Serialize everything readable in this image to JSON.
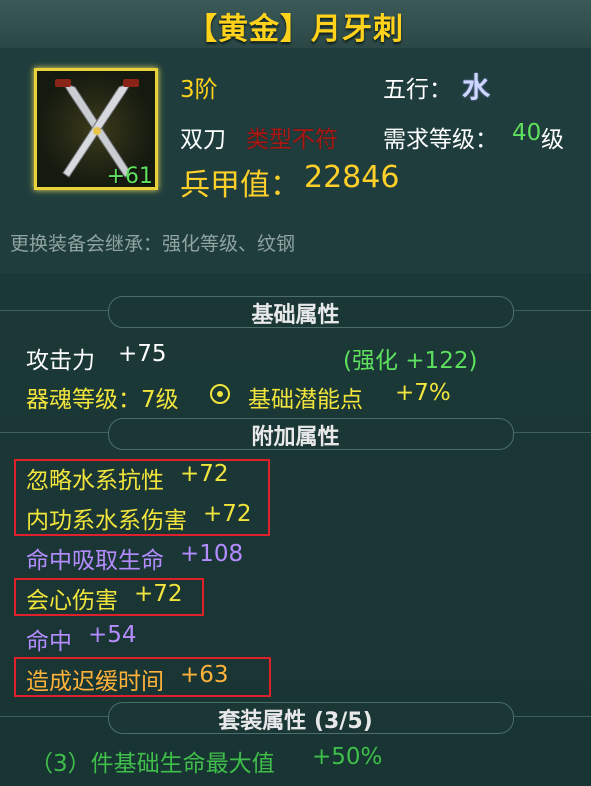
{
  "item": {
    "title": "【黄金】月牙刺",
    "plus_level": "+61",
    "tier": "3阶",
    "element_label": "五行：",
    "element_value": "水",
    "weapon_type": "双刀",
    "class_restriction": "类型不符",
    "level_req_label": "需求等级：",
    "level_req_value": "40",
    "level_req_unit": "级",
    "power_label": "兵甲值：",
    "power_value": "22846",
    "inherit_hint": "更换装备会继承：强化等级、纹钢"
  },
  "sections": {
    "base_title": "基础属性",
    "extra_title": "附加属性",
    "set_title": "套装属性 (3/5)"
  },
  "base": {
    "attack_label": "攻击力",
    "attack_value": "+75",
    "enhance": "(强化 +122)",
    "soul_level": "器魂等级：7级",
    "potential_label": "基础潜能点",
    "potential_value": "+7%"
  },
  "extra": [
    {
      "label": "忽略水系抗性",
      "value": "+72",
      "color": "#f1e43c"
    },
    {
      "label": "内功系水系伤害",
      "value": "+72",
      "color": "#f1e43c"
    },
    {
      "label": "命中吸取生命",
      "value": "+108",
      "color": "#b48cff"
    },
    {
      "label": "会心伤害",
      "value": "+72",
      "color": "#f1e43c"
    },
    {
      "label": "命中",
      "value": "+54",
      "color": "#b48cff"
    },
    {
      "label": "造成迟缓时间",
      "value": "+63",
      "color": "#ffb23a"
    }
  ],
  "set_bonus": {
    "text": "（3）件基础生命最大值",
    "value": "+50%"
  },
  "colors": {
    "title": "#ffd21c",
    "highlight_box": "#e0202a",
    "background": "#1a3837"
  }
}
